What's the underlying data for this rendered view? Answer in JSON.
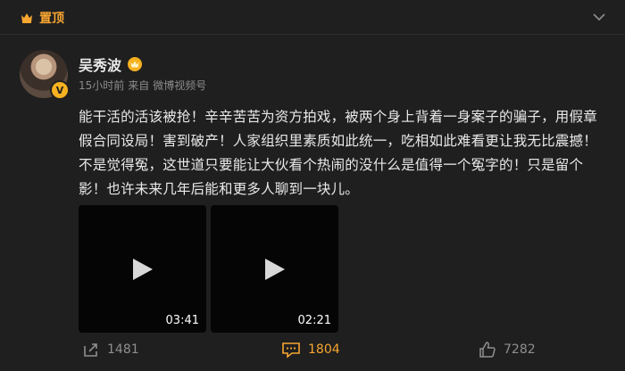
{
  "pinned": {
    "label": "置顶",
    "accent": "#f7a631"
  },
  "user": {
    "name": "吴秀波",
    "badge_color": "#f5b120"
  },
  "meta": {
    "time": "15小时前",
    "source_prefix": "来自",
    "source": "微博视频号"
  },
  "post": {
    "text": "能干活的活该被抢！辛辛苦苦为资方拍戏，被两个身上背着一身案子的骗子，用假章假合同设局！害到破产！人家组织里素质如此统一，吃相如此难看更让我无比震撼！不是觉得冤，这世道只要能让大伙看个热闹的没什么是值得一个冤字的！只是留个影！也许未来几年后能和更多人聊到一块儿。"
  },
  "videos": [
    {
      "duration": "03:41"
    },
    {
      "duration": "02:21"
    }
  ],
  "actions": {
    "repost_count": "1481",
    "comment_count": "1804",
    "like_count": "7282"
  },
  "icons": {
    "pin": "crown-pin-icon",
    "menu": "chevron-down-icon",
    "verified": "verified-v-icon",
    "repost": "share-arrow-icon",
    "comment": "comment-bubble-icon",
    "like": "thumbs-up-icon",
    "play": "play-icon"
  }
}
